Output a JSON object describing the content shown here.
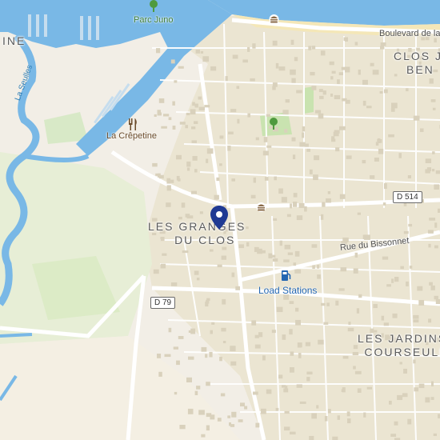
{
  "map": {
    "districts": [
      {
        "line1": "LES GRANGES",
        "line2": "DU CLOS"
      },
      {
        "line1": "LES JARDINS",
        "line2": "COURSEULL"
      },
      {
        "line1": "CLOS J",
        "line2": "BEN"
      },
      {
        "line1": "INE"
      }
    ],
    "streets": {
      "boulevard": "Boulevard de la",
      "bissonnet": "Rue du Bissonnet"
    },
    "route_shields": {
      "d514": "D 514",
      "d79": "D 79"
    },
    "water": {
      "river": "La Seulles"
    },
    "pois": {
      "park": "Parc Juno",
      "restaurant": "La Crêpetine",
      "charging": "Load Stations"
    },
    "colors": {
      "land": "#f2eee6",
      "urban": "#e9e3cf",
      "water": "#79b8e6",
      "park": "#cfe5b7",
      "road": "#ffffff",
      "marker": "#1f3a93"
    }
  }
}
